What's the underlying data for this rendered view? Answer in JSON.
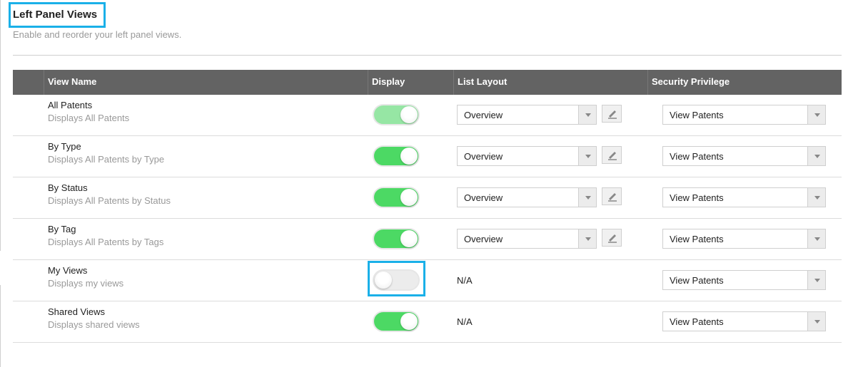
{
  "header": {
    "title": "Left Panel Views",
    "subtitle": "Enable and reorder your left panel views."
  },
  "table": {
    "columns": [
      "",
      "View Name",
      "Display",
      "List Layout",
      "Security Privilege"
    ],
    "rows": [
      {
        "name": "All Patents",
        "description": "Displays All Patents",
        "display": "on",
        "display_disabled": true,
        "list_layout": "Overview",
        "security_privilege": "View Patents"
      },
      {
        "name": "By Type",
        "description": "Displays All Patents by Type",
        "display": "on",
        "display_disabled": false,
        "list_layout": "Overview",
        "security_privilege": "View Patents"
      },
      {
        "name": "By Status",
        "description": "Displays All Patents by Status",
        "display": "on",
        "display_disabled": false,
        "list_layout": "Overview",
        "security_privilege": "View Patents"
      },
      {
        "name": "By Tag",
        "description": "Displays All Patents by Tags",
        "display": "on",
        "display_disabled": false,
        "list_layout": "Overview",
        "security_privilege": "View Patents"
      },
      {
        "name": "My Views",
        "description": "Displays my views",
        "display": "off",
        "display_disabled": false,
        "list_layout": "N/A",
        "security_privilege": "View Patents",
        "highlighted": true
      },
      {
        "name": "Shared Views",
        "description": "Displays shared views",
        "display": "on",
        "display_disabled": false,
        "list_layout": "N/A",
        "security_privilege": "View Patents"
      }
    ]
  },
  "colors": {
    "highlight": "#1ab0e8",
    "toggle_on": "#4cd964",
    "toggle_on_disabled": "#96e6a4",
    "header_bg": "#636363"
  }
}
